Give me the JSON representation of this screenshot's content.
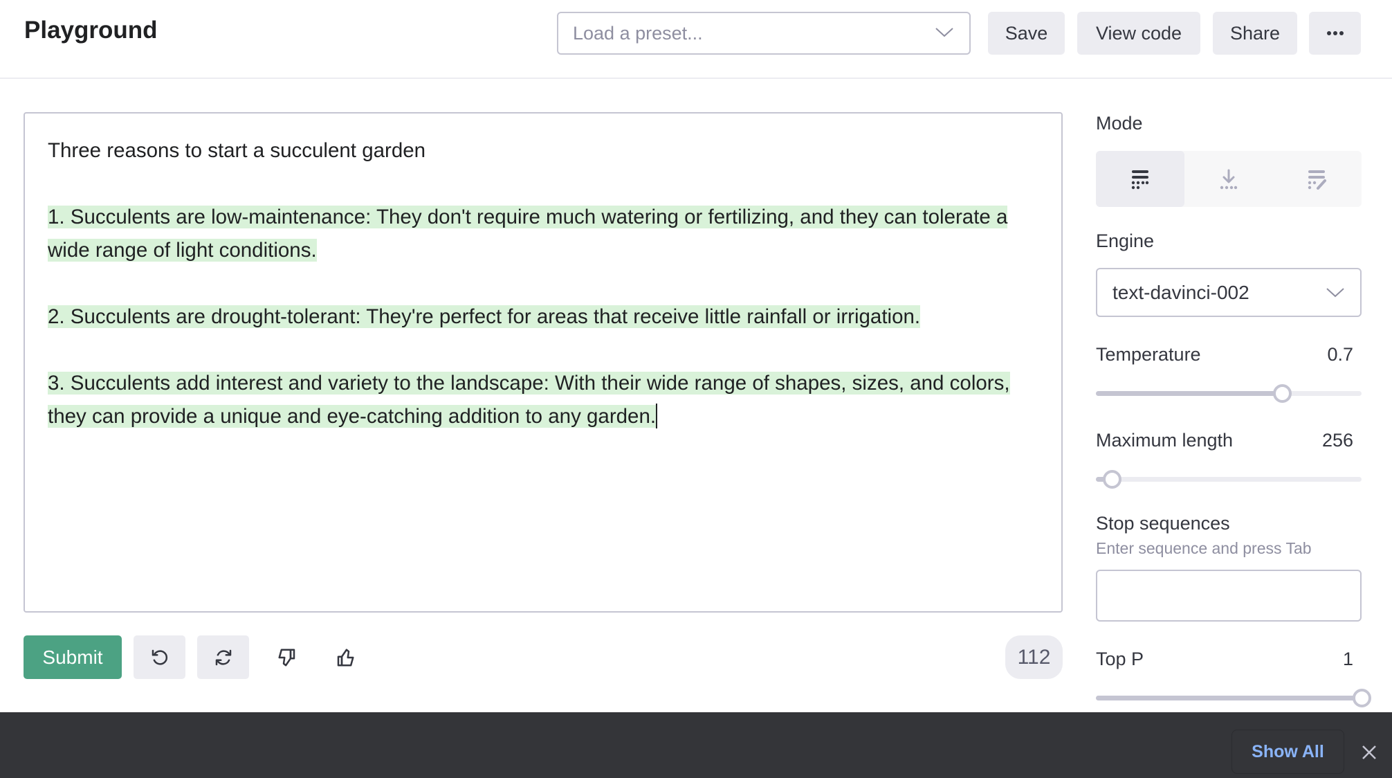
{
  "header": {
    "title": "Playground",
    "preset_placeholder": "Load a preset...",
    "save_label": "Save",
    "view_code_label": "View code",
    "share_label": "Share",
    "more_label": "•••"
  },
  "editor": {
    "prompt": "Three reasons to start a succulent garden",
    "completion": [
      "1. Succulents are low-maintenance: They don't require much watering or fertilizing, and they can tolerate a wide range of light conditions.",
      "2. Succulents are drought-tolerant: They're perfect for areas that receive little rainfall or irrigation.",
      "3. Succulents add interest and variety to the landscape: With their wide range of shapes, sizes, and colors, they can provide a unique and eye-catching addition to any garden."
    ],
    "highlight_color": "#d9f2d9"
  },
  "actions": {
    "submit_label": "Submit",
    "submit_color": "#4ca283",
    "token_count": "112"
  },
  "settings": {
    "mode_label": "Mode",
    "modes": [
      {
        "name": "complete",
        "icon": "complete-mode-icon",
        "active": true
      },
      {
        "name": "insert",
        "icon": "insert-mode-icon",
        "active": false
      },
      {
        "name": "edit",
        "icon": "edit-mode-icon",
        "active": false
      }
    ],
    "engine_label": "Engine",
    "engine_value": "text-davinci-002",
    "temperature_label": "Temperature",
    "temperature_value": "0.7",
    "temperature_fraction": 0.7,
    "max_length_label": "Maximum length",
    "max_length_value": "256",
    "max_length_fraction": 0.06,
    "stop_sequences_label": "Stop sequences",
    "stop_sequences_hint": "Enter sequence and press Tab",
    "stop_sequences_value": "",
    "top_p_label": "Top P",
    "top_p_value": "1",
    "top_p_fraction": 1.0
  },
  "footer": {
    "show_all_label": "Show All",
    "show_all_color": "#8ab4f8"
  }
}
